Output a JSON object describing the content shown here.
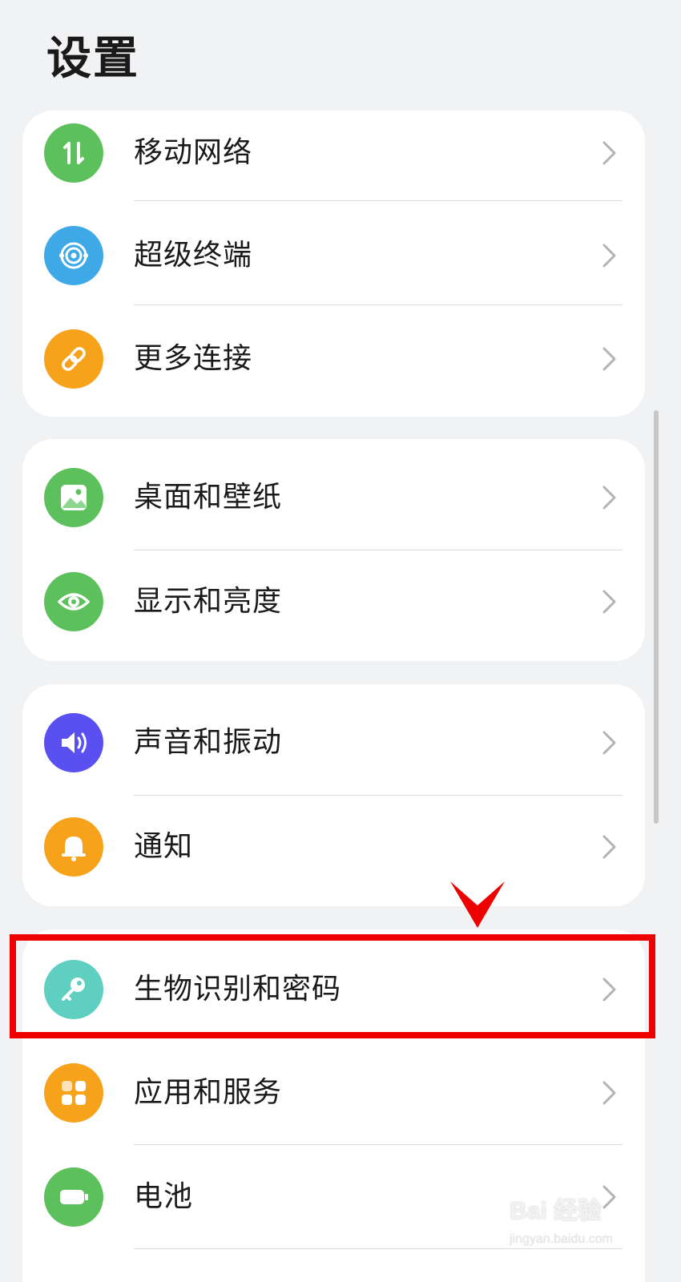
{
  "header": {
    "title": "设置"
  },
  "groups": [
    {
      "items": [
        {
          "label": "移动网络",
          "icon": "mobile-network-icon",
          "color": "#5cc15c"
        },
        {
          "label": "超级终端",
          "icon": "super-device-icon",
          "color": "#3fa9e8"
        },
        {
          "label": "更多连接",
          "icon": "link-icon",
          "color": "#f7a21b"
        }
      ]
    },
    {
      "items": [
        {
          "label": "桌面和壁纸",
          "icon": "wallpaper-icon",
          "color": "#5cc15c"
        },
        {
          "label": "显示和亮度",
          "icon": "eye-icon",
          "color": "#5cc15c"
        }
      ]
    },
    {
      "items": [
        {
          "label": "声音和振动",
          "icon": "speaker-icon",
          "color": "#5a4ff0"
        },
        {
          "label": "通知",
          "icon": "bell-icon",
          "color": "#f7a21b"
        }
      ]
    },
    {
      "items": [
        {
          "label": "生物识别和密码",
          "icon": "key-icon",
          "color": "#5ecfc0"
        },
        {
          "label": "应用和服务",
          "icon": "apps-icon",
          "color": "#f7a21b"
        },
        {
          "label": "电池",
          "icon": "battery-icon",
          "color": "#5cc15c"
        }
      ]
    }
  ],
  "annotation": {
    "highlight_color": "#ee0000"
  },
  "watermark": {
    "brand": "Bai 经验",
    "url": "jingyan.baidu.com"
  }
}
